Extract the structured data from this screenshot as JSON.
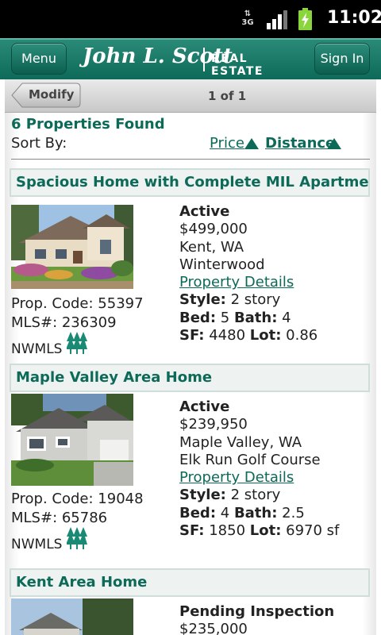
{
  "status_bar": {
    "network": "3G",
    "time": "11:02"
  },
  "header": {
    "menu_label": "Menu",
    "logo_name": "John L. Scott",
    "logo_tagline": "REAL ESTATE",
    "signin_label": "Sign In"
  },
  "subbar": {
    "modify_label": "Modify",
    "page_label": "1 of 1"
  },
  "results": {
    "found_label": "6 Properties Found",
    "sort_by_label": "Sort By:",
    "sort_price_label": "Price",
    "sort_distance_label": "Distance"
  },
  "listings": [
    {
      "title": "Spacious Home with Complete MIL Apartment",
      "prop_code": "Prop. Code: 55397",
      "mls": "MLS#: 236309",
      "nwmls": "NWMLS",
      "status": "Active",
      "price": "$499,000",
      "city": "Kent, WA",
      "area": "Winterwood",
      "details_label": "Property Details",
      "style_label": "Style:",
      "style_value": "2 story",
      "bed_label": "Bed:",
      "bed_value": "5",
      "bath_label": "Bath:",
      "bath_value": "4",
      "sf_label": "SF:",
      "sf_value": "4480",
      "lot_label": "Lot:",
      "lot_value": "0.86"
    },
    {
      "title": "Maple Valley Area Home",
      "prop_code": "Prop. Code: 19048",
      "mls": "MLS#: 65786",
      "nwmls": "NWMLS",
      "status": "Active",
      "price": "$239,950",
      "city": "Maple Valley, WA",
      "area": "Elk Run Golf Course",
      "details_label": "Property Details",
      "style_label": "Style:",
      "style_value": "2 story",
      "bed_label": "Bed:",
      "bed_value": "4",
      "bath_label": "Bath:",
      "bath_value": "2.5",
      "sf_label": "SF:",
      "sf_value": "1850",
      "lot_label": "Lot:",
      "lot_value": "6970 sf"
    },
    {
      "title": "Kent Area Home",
      "status": "Pending Inspection",
      "price": "$235,000"
    }
  ],
  "colors": {
    "brand_green": "#0d6a58",
    "header_green": "#1a7a67",
    "title_bg": "#eef3f2"
  },
  "icons": {
    "network": "3g-arrows-icon",
    "signal": "signal-bars-icon",
    "battery": "battery-charging-icon",
    "sort_arrow": "triangle-up-icon",
    "nwmls": "nwmls-trees-icon"
  }
}
